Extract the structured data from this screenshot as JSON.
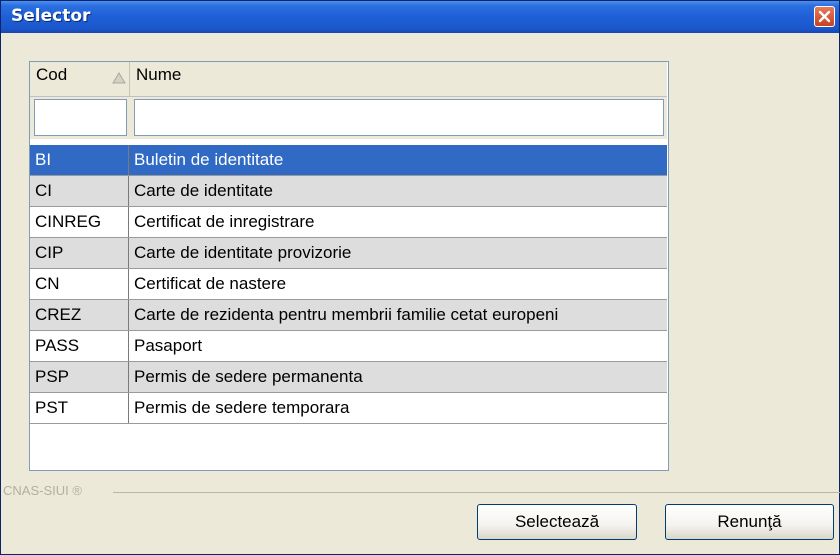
{
  "window": {
    "title": "Selector"
  },
  "table": {
    "columns": {
      "cod": "Cod",
      "nume": "Nume"
    },
    "filters": {
      "cod": "",
      "nume": ""
    },
    "rows": [
      {
        "cod": "BI",
        "nume": "Buletin de identitate"
      },
      {
        "cod": "CI",
        "nume": "Carte de identitate"
      },
      {
        "cod": "CINREG",
        "nume": "Certificat de inregistrare"
      },
      {
        "cod": "CIP",
        "nume": "Carte de identitate provizorie"
      },
      {
        "cod": "CN",
        "nume": "Certificat de nastere"
      },
      {
        "cod": "CREZ",
        "nume": "Carte de rezidenta pentru membrii familie cetat europeni"
      },
      {
        "cod": "PASS",
        "nume": "Pasaport"
      },
      {
        "cod": "PSP",
        "nume": "Permis de sedere permanenta"
      },
      {
        "cod": "PST",
        "nume": "Permis de sedere temporara"
      }
    ]
  },
  "footer": {
    "brand": "CNAS-SIUI ®"
  },
  "buttons": {
    "select": "Selectează",
    "cancel": "Renunţă"
  },
  "colors": {
    "title_bar": "#1f5fd6",
    "selection": "#316ac5",
    "alt_row": "#dddddd",
    "close": "#d5532f"
  }
}
